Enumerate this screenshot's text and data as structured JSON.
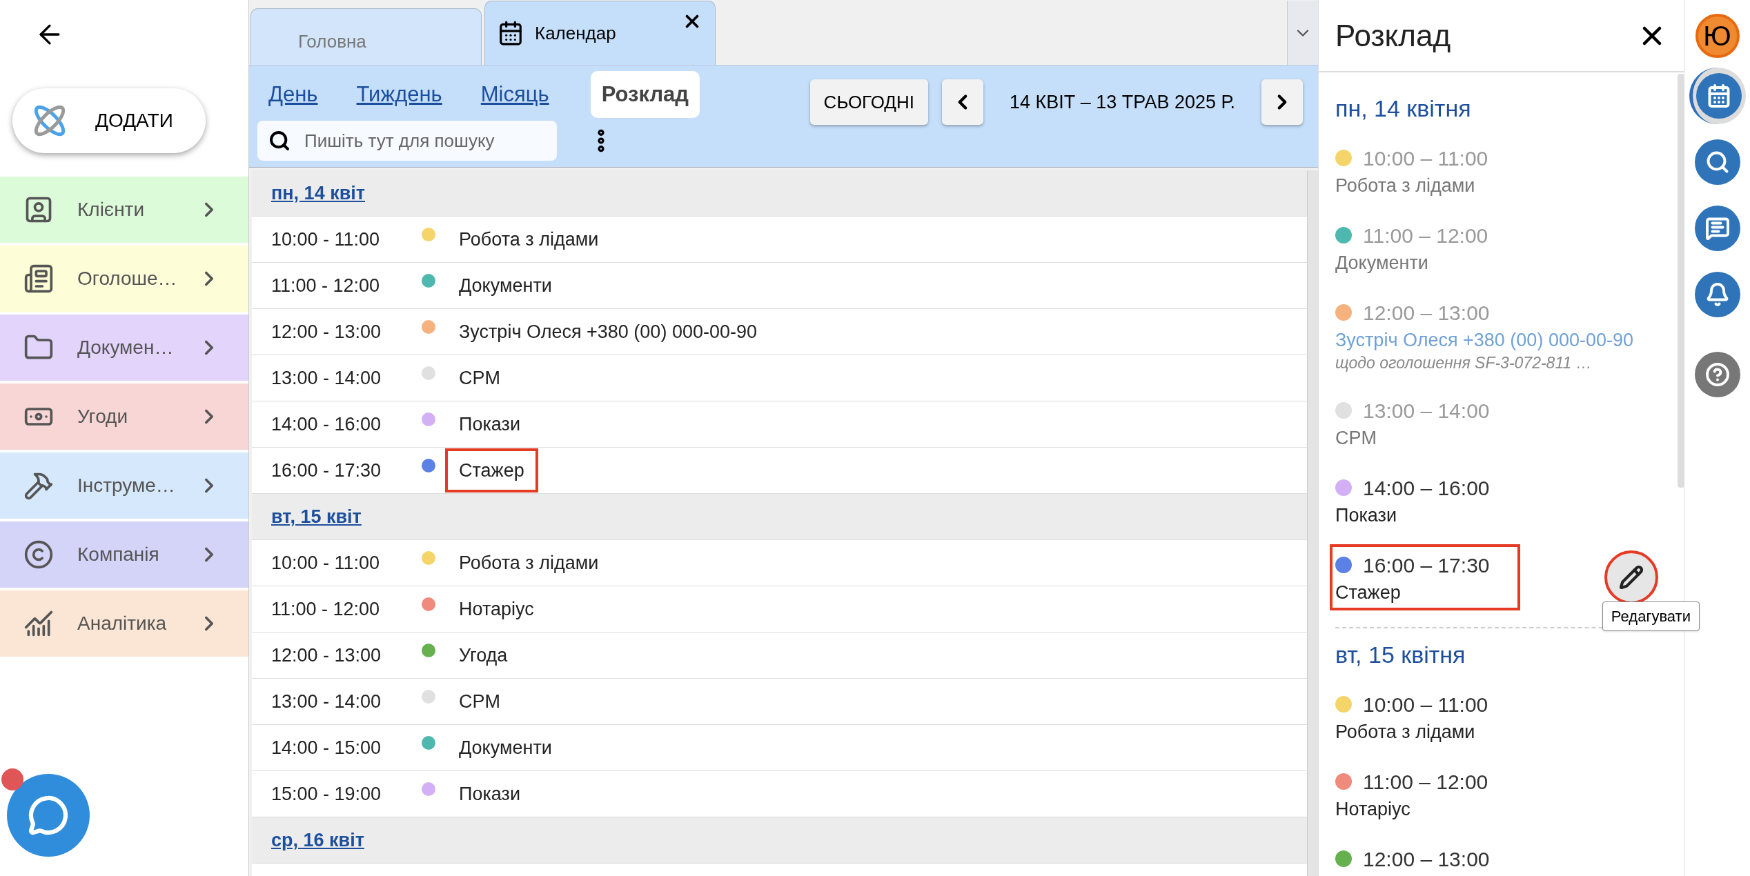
{
  "sidebar": {
    "add_button": "ДОДАТИ",
    "items": [
      {
        "label": "Клієнти",
        "color": "#dcfbd8"
      },
      {
        "label": "Оголоше…",
        "color": "#fdfdd8"
      },
      {
        "label": "Докумен…",
        "color": "#e3d4fb"
      },
      {
        "label": "Угоди",
        "color": "#f8d6d6"
      },
      {
        "label": "Інструме…",
        "color": "#d6e8fb"
      },
      {
        "label": "Компанія",
        "color": "#d4d4f8"
      },
      {
        "label": "Аналітика",
        "color": "#fbe6d6"
      }
    ],
    "chat_unread": true
  },
  "tabs": [
    {
      "label": "Головна",
      "selected": false
    },
    {
      "label": "Календар",
      "selected": true
    }
  ],
  "toolbar": {
    "views": [
      {
        "label": "День",
        "selected": false
      },
      {
        "label": "Тиждень",
        "selected": false
      },
      {
        "label": "Місяць",
        "selected": false
      },
      {
        "label": "Розклад",
        "selected": true
      }
    ],
    "today_button": "СЬОГОДНІ",
    "range": "14 КВІТ – 13 ТРАВ 2025 Р.",
    "search": {
      "placeholder": "Пишіть тут для пошуку"
    }
  },
  "agenda": [
    {
      "day": "пн, 14 квіт",
      "events": [
        {
          "time": "10:00 - 11:00",
          "title": "Робота з лідами",
          "color": "#f5d56a",
          "highlighted": false
        },
        {
          "time": "11:00 - 12:00",
          "title": "Документи",
          "color": "#4fb8ae",
          "highlighted": false
        },
        {
          "time": "12:00 - 13:00",
          "title": "Зустріч Олеся +380 (00) 000-00-90",
          "color": "#f5b27e",
          "highlighted": false
        },
        {
          "time": "13:00 - 14:00",
          "title": "CPM",
          "color": "#e0e0e0",
          "highlighted": false
        },
        {
          "time": "14:00 - 16:00",
          "title": "Покази",
          "color": "#d3b0f5",
          "highlighted": false
        },
        {
          "time": "16:00 - 17:30",
          "title": "Стажер",
          "color": "#5b80e6",
          "highlighted": true
        }
      ]
    },
    {
      "day": "вт, 15 квіт",
      "events": [
        {
          "time": "10:00 - 11:00",
          "title": "Робота з лідами",
          "color": "#f5d56a",
          "highlighted": false
        },
        {
          "time": "11:00 - 12:00",
          "title": "Нотаріус",
          "color": "#ef8a7c",
          "highlighted": false
        },
        {
          "time": "12:00 - 13:00",
          "title": "Угода",
          "color": "#66b050",
          "highlighted": false
        },
        {
          "time": "13:00 - 14:00",
          "title": "CPM",
          "color": "#e0e0e0",
          "highlighted": false
        },
        {
          "time": "14:00 - 15:00",
          "title": "Документи",
          "color": "#4fb8ae",
          "highlighted": false
        },
        {
          "time": "15:00 - 19:00",
          "title": "Покази",
          "color": "#d3b0f5",
          "highlighted": false
        }
      ]
    },
    {
      "day": "ср, 16 квіт"
    }
  ],
  "schedule_panel": {
    "title": "Розклад",
    "days": [
      {
        "day": "пн, 14 квітня",
        "events": [
          {
            "kind": "task",
            "time": "10:00 – 11:00",
            "title": "Робота з лідами",
            "color": "#f5d56a",
            "past": true,
            "highlighted": false
          },
          {
            "kind": "task",
            "time": "11:00 – 12:00",
            "title": "Документи",
            "color": "#4fb8ae",
            "past": true,
            "highlighted": false
          },
          {
            "kind": "meeting",
            "time": "12:00 – 13:00",
            "title": "Зустріч Олеся +380 (00) 000-00-90",
            "subtitle": "щодо оголошення SF-3-072-811 …",
            "color": "#f5b27e",
            "past": true,
            "highlighted": false
          },
          {
            "kind": "task",
            "time": "13:00 – 14:00",
            "title": "CPM",
            "color": "#e0e0e0",
            "past": true,
            "highlighted": false
          },
          {
            "kind": "task",
            "time": "14:00 – 16:00",
            "title": "Покази",
            "color": "#d3b0f5",
            "past": false,
            "highlighted": false
          },
          {
            "kind": "task",
            "time": "16:00 – 17:30",
            "title": "Стажер",
            "color": "#5b80e6",
            "past": false,
            "highlighted": true,
            "edit_tooltip": "Редагувати"
          }
        ]
      },
      {
        "day": "вт, 15 квітня",
        "events": [
          {
            "kind": "task",
            "time": "10:00 – 11:00",
            "title": "Робота з лідами",
            "color": "#f5d56a",
            "past": false,
            "highlighted": false
          },
          {
            "kind": "task",
            "time": "11:00 – 12:00",
            "title": "Нотаріус",
            "color": "#ef8a7c",
            "past": false,
            "highlighted": false
          },
          {
            "time": "12:00 – 13:00",
            "color": "#66b050",
            "past": false,
            "highlighted": false
          }
        ]
      }
    ]
  },
  "right_bar": {
    "avatar": "Ю",
    "buttons": [
      {
        "kind": "calendar",
        "selected": true
      },
      {
        "kind": "search",
        "selected": false
      },
      {
        "kind": "chat",
        "selected": false
      },
      {
        "kind": "bell",
        "selected": false
      },
      {
        "kind": "help",
        "selected": false
      }
    ]
  }
}
